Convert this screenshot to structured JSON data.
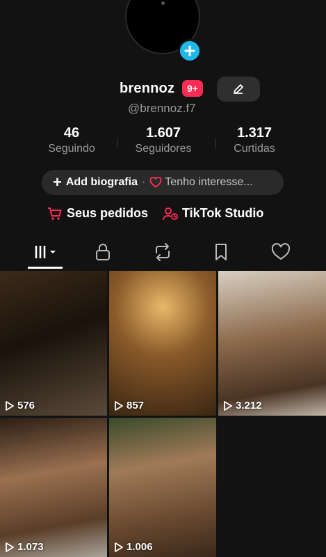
{
  "profile": {
    "username": "brennoz",
    "badge": "9+",
    "handle": "@brennoz.f7"
  },
  "stats": [
    {
      "value": "46",
      "label": "Seguindo"
    },
    {
      "value": "1.607",
      "label": "Seguidores"
    },
    {
      "value": "1.317",
      "label": "Curtidas"
    }
  ],
  "bio": {
    "add_label": "Add biografia",
    "separator": "·",
    "interest_label": "Tenho interesse..."
  },
  "links": {
    "orders": "Seus pedidos",
    "studio": "TikTok Studio"
  },
  "colors": {
    "accent": "#fe2c55",
    "add_button": "#20b8e8",
    "background": "#121212"
  },
  "tabs": [
    "videos-grid-icon",
    "lock-icon",
    "repost-icon",
    "bookmark-icon",
    "heart-icon"
  ],
  "videos": [
    {
      "views": "576"
    },
    {
      "views": "857"
    },
    {
      "views": "3.212"
    },
    {
      "views": "1.073"
    },
    {
      "views": "1.006"
    }
  ]
}
